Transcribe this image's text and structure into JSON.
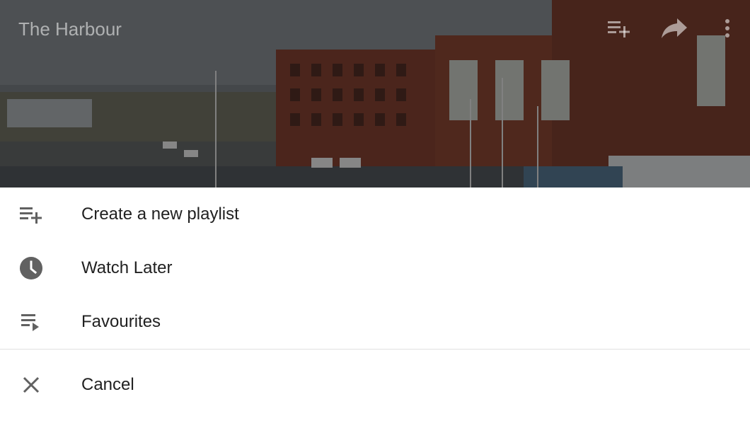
{
  "video": {
    "title": "The Harbour",
    "actions": [
      {
        "icon": "playlist-add-icon"
      },
      {
        "icon": "share-icon"
      },
      {
        "icon": "more-vert-icon"
      }
    ]
  },
  "sheet": {
    "items": [
      {
        "label": "Create a new playlist",
        "icon": "playlist-add-icon"
      },
      {
        "label": "Watch Later",
        "icon": "clock-icon"
      },
      {
        "label": "Favourites",
        "icon": "playlist-play-icon"
      }
    ],
    "cancel_label": "Cancel",
    "cancel_icon": "close-icon"
  },
  "colors": {
    "text": "#212121",
    "icon": "#616161",
    "divider": "#e0e0e0"
  }
}
